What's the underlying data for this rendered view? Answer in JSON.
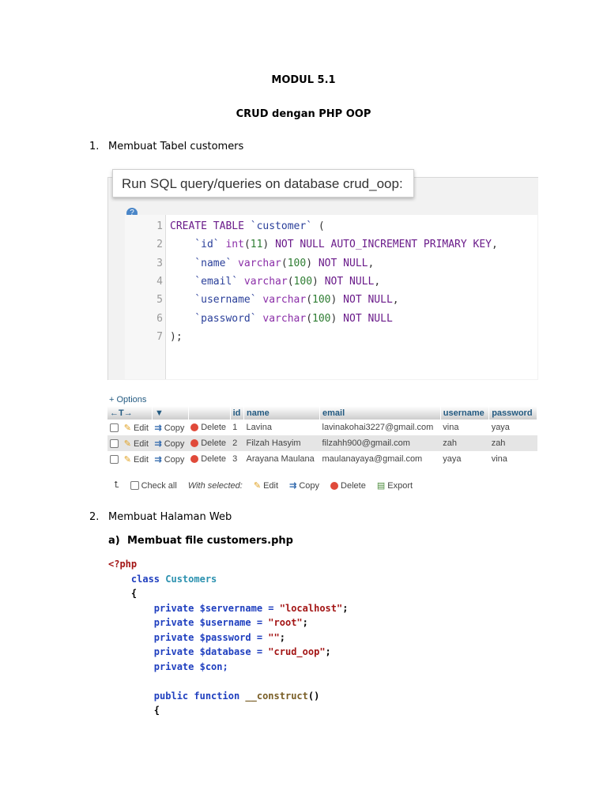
{
  "document": {
    "title": "MODUL 5.1",
    "subtitle": "CRUD dengan PHP OOP",
    "section1": {
      "number": "1.",
      "label": "Membuat Tabel customers"
    },
    "section2": {
      "number": "2.",
      "label": "Membuat Halaman Web"
    },
    "section2a": {
      "number": "a)",
      "label": "Membuat file customers.php"
    }
  },
  "sql_panel": {
    "header": "Run SQL query/queries on database crud_oop:",
    "help_icon": "?",
    "lines": [
      [
        [
          "CREATE TABLE ",
          "kw"
        ],
        [
          "`customer`",
          "id"
        ],
        [
          " (",
          "plain"
        ]
      ],
      [
        [
          "    `id` ",
          "id"
        ],
        [
          "int",
          "type"
        ],
        [
          "(",
          "plain"
        ],
        [
          "11",
          "num"
        ],
        [
          ") ",
          "plain"
        ],
        [
          "NOT NULL AUTO_INCREMENT PRIMARY KEY",
          "kw"
        ],
        [
          ",",
          "plain"
        ]
      ],
      [
        [
          "    `name` ",
          "id"
        ],
        [
          "varchar",
          "type"
        ],
        [
          "(",
          "plain"
        ],
        [
          "100",
          "num"
        ],
        [
          ") ",
          "plain"
        ],
        [
          "NOT NULL",
          "kw"
        ],
        [
          ",",
          "plain"
        ]
      ],
      [
        [
          "    `email` ",
          "id"
        ],
        [
          "varchar",
          "type"
        ],
        [
          "(",
          "plain"
        ],
        [
          "100",
          "num"
        ],
        [
          ") ",
          "plain"
        ],
        [
          "NOT NULL",
          "kw"
        ],
        [
          ",",
          "plain"
        ]
      ],
      [
        [
          "    `username` ",
          "id"
        ],
        [
          "varchar",
          "type"
        ],
        [
          "(",
          "plain"
        ],
        [
          "100",
          "num"
        ],
        [
          ") ",
          "plain"
        ],
        [
          "NOT NULL",
          "kw"
        ],
        [
          ",",
          "plain"
        ]
      ],
      [
        [
          "    `password` ",
          "id"
        ],
        [
          "varchar",
          "type"
        ],
        [
          "(",
          "plain"
        ],
        [
          "100",
          "num"
        ],
        [
          ") ",
          "plain"
        ],
        [
          "NOT NULL",
          "kw"
        ]
      ],
      [
        [
          ");",
          "plain"
        ]
      ]
    ]
  },
  "table": {
    "options_label": "+ Options",
    "sort_arrows": "←T→",
    "columns": [
      "id",
      "name",
      "email",
      "username",
      "password"
    ],
    "actions": {
      "edit": "Edit",
      "copy": "Copy",
      "delete": "Delete"
    },
    "rows": [
      {
        "id": "1",
        "name": "Lavina",
        "email": "lavinakohai3227@gmail.com",
        "username": "vina",
        "password": "yaya"
      },
      {
        "id": "2",
        "name": "Filzah Hasyim",
        "email": "filzahh900@gmail.com",
        "username": "zah",
        "password": "zah"
      },
      {
        "id": "3",
        "name": "Arayana Maulana",
        "email": "maulanayaya@gmail.com",
        "username": "yaya",
        "password": "vina"
      }
    ],
    "footer": {
      "check_all": "Check all",
      "with_selected": "With selected:",
      "edit": "Edit",
      "copy": "Copy",
      "delete": "Delete",
      "export": "Export"
    }
  },
  "php_code": [
    [
      [
        "<?php",
        "tag"
      ]
    ],
    [
      [
        "    class ",
        "kw"
      ],
      [
        "Customers",
        "cls"
      ]
    ],
    [
      [
        "    {",
        "plain"
      ]
    ],
    [
      [
        "        private $servername = ",
        "kw"
      ],
      [
        "\"localhost\"",
        "str"
      ],
      [
        ";",
        "plain"
      ]
    ],
    [
      [
        "        private $username = ",
        "kw"
      ],
      [
        "\"root\"",
        "str"
      ],
      [
        ";",
        "plain"
      ]
    ],
    [
      [
        "        private $password = ",
        "kw"
      ],
      [
        "\"\"",
        "str"
      ],
      [
        ";",
        "plain"
      ]
    ],
    [
      [
        "        private $database = ",
        "kw"
      ],
      [
        "\"crud_oop\"",
        "str"
      ],
      [
        ";",
        "plain"
      ]
    ],
    [
      [
        "        private $con;",
        "kw"
      ]
    ],
    [
      [
        "",
        "plain"
      ]
    ],
    [
      [
        "        public function ",
        "kw"
      ],
      [
        "__construct",
        "fn"
      ],
      [
        "()",
        "plain"
      ]
    ],
    [
      [
        "        {",
        "plain"
      ]
    ]
  ],
  "colors": {
    "link": "#235a81",
    "sql_keyword": "#6a1b8a",
    "php_keyword": "#1f3fbf",
    "php_string": "#a31515"
  }
}
